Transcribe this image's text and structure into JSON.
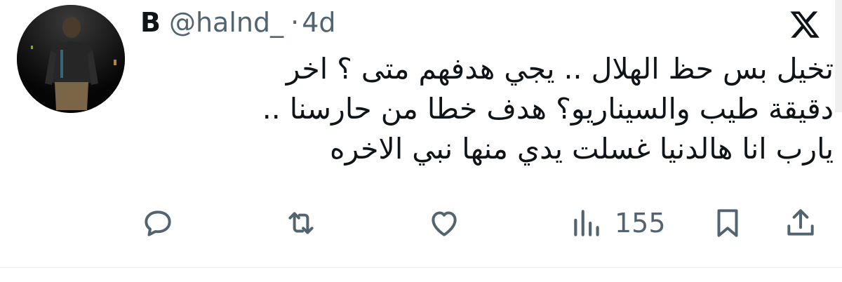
{
  "author": {
    "display_name": "B",
    "handle": "@halnd_",
    "separator": "·",
    "age": "4d"
  },
  "tweet": {
    "lines": [
      "تخيل بس حظ الهلال .. يجي هدفهم متى ؟ اخر",
      "دقيقة طيب والسيناريو؟ هدف خطا من حارسنا ..",
      "يارب انا هالدنيا غسلت يدي منها نبي الاخره"
    ]
  },
  "actions": {
    "reply_icon": "reply-bubble-icon",
    "repost_icon": "repost-arrows-icon",
    "like_icon": "heart-icon",
    "views_icon": "bar-chart-icon",
    "views_count": "155",
    "bookmark_icon": "bookmark-icon",
    "share_icon": "share-upload-icon"
  },
  "colors": {
    "text_primary": "#0f1419",
    "text_secondary": "#536471",
    "background": "#ffffff"
  }
}
